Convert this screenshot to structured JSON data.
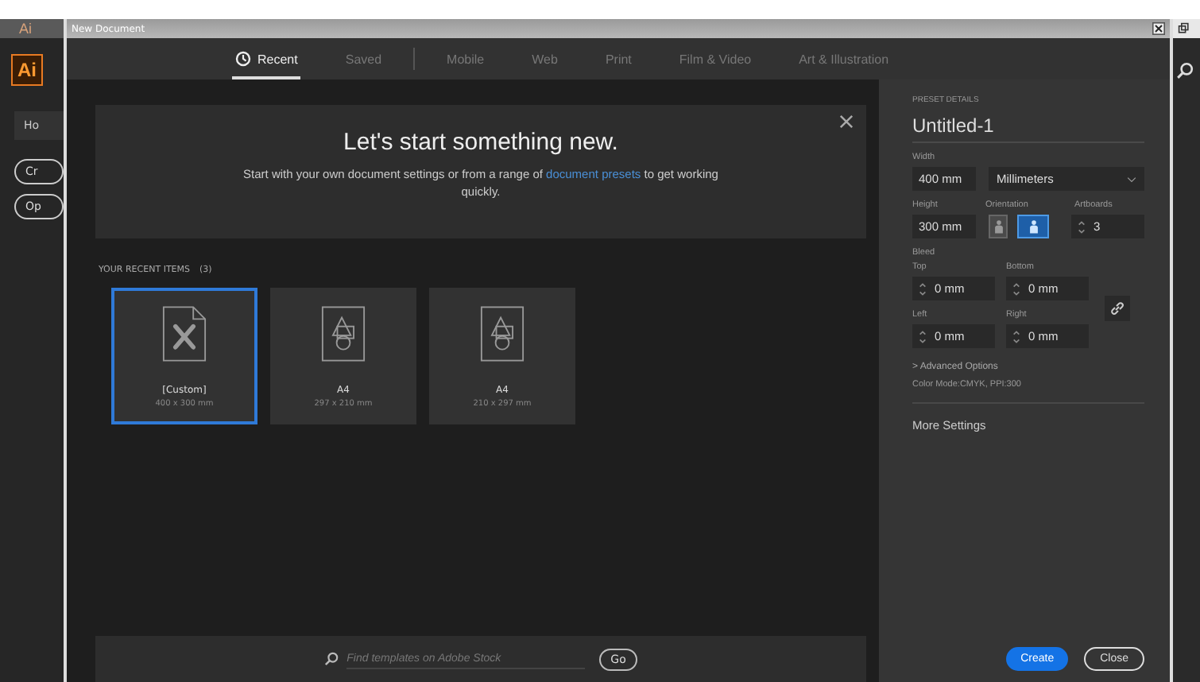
{
  "app": {
    "title_logo": "Ai",
    "logo": "Ai",
    "home_button": "Ho",
    "buttons": [
      "Cr",
      "Op"
    ]
  },
  "window": {
    "title": "New Document"
  },
  "tabs": [
    {
      "label": "Recent",
      "selected": true,
      "icon": true
    },
    {
      "label": "Saved",
      "selected": false,
      "divider_after": true
    },
    {
      "label": "Mobile",
      "selected": false
    },
    {
      "label": "Web",
      "selected": false
    },
    {
      "label": "Print",
      "selected": false
    },
    {
      "label": "Film & Video",
      "selected": false
    },
    {
      "label": "Art & Illustration",
      "selected": false
    }
  ],
  "banner": {
    "title": "Let's start something new.",
    "text_before": "Start with your own document settings or from a range of ",
    "link": "document presets",
    "text_after": " to get working quickly."
  },
  "recent": {
    "heading": "YOUR RECENT ITEMS",
    "count": "(3)",
    "items": [
      {
        "name": "[Custom]",
        "size": "400 x 300 mm",
        "kind": "custom",
        "selected": true
      },
      {
        "name": "A4",
        "size": "297 x 210 mm",
        "kind": "preset",
        "selected": false
      },
      {
        "name": "A4",
        "size": "210 x 297 mm",
        "kind": "preset",
        "selected": false
      }
    ]
  },
  "search": {
    "placeholder": "Find templates on Adobe Stock",
    "button": "Go"
  },
  "preset": {
    "heading": "PRESET DETAILS",
    "name": "Untitled-1",
    "width_label": "Width",
    "width": "400 mm",
    "units": "Millimeters",
    "height_label": "Height",
    "height": "300 mm",
    "orientation_label": "Orientation",
    "orientations": [
      {
        "kind": "portrait",
        "selected": false
      },
      {
        "kind": "landscape",
        "selected": true
      }
    ],
    "artboards_label": "Artboards",
    "artboards": "3",
    "bleed_label": "Bleed",
    "bleed": [
      {
        "label": "Top",
        "value": "0 mm"
      },
      {
        "label": "Bottom",
        "value": "0 mm"
      },
      {
        "label": "Left",
        "value": "0 mm"
      },
      {
        "label": "Right",
        "value": "0 mm"
      }
    ],
    "advanced": "> Advanced Options",
    "color_mode": "Color Mode:CMYK, PPI:300",
    "more": "More Settings"
  },
  "actions": [
    {
      "label": "Create",
      "kind": "primary"
    },
    {
      "label": "Close",
      "kind": "secondary"
    }
  ]
}
